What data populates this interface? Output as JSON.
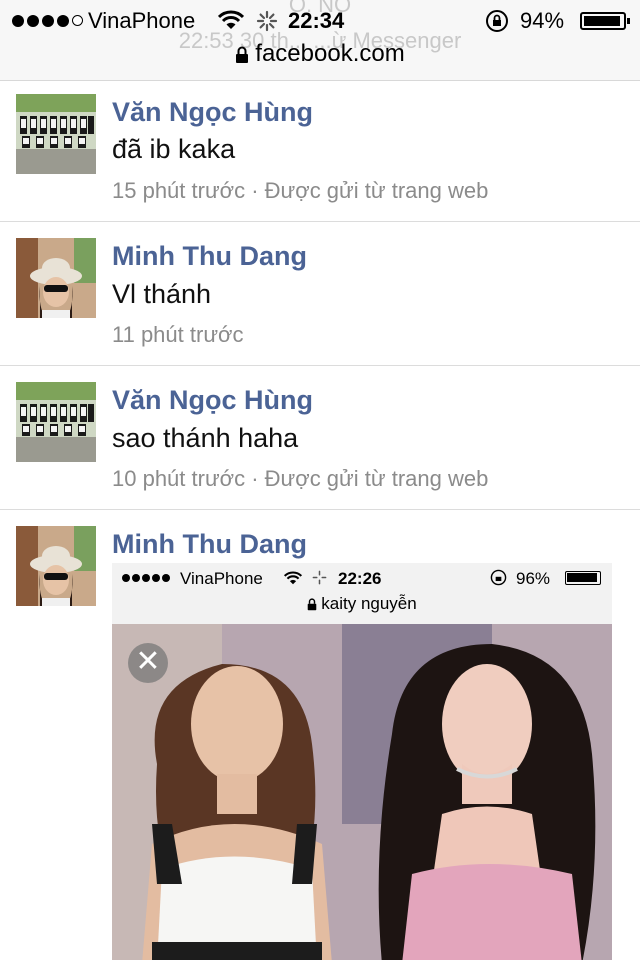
{
  "status_bar": {
    "carrier": "VinaPhone",
    "time": "22:34",
    "battery": "94%",
    "battery_level": 0.94,
    "url": "facebook.com",
    "ghost_top": "Ô. NO",
    "ghost_text": "22:53 30 th... ...ừ Messenger"
  },
  "messages": [
    {
      "name": "Văn Ngọc Hùng",
      "text": "đã ib kaka",
      "meta": "15 phút trước · Được gửi từ trang web",
      "avatar": "group-photo-avatar"
    },
    {
      "name": "Minh Thu Dang",
      "text": "Vl thánh",
      "meta": "11 phút trước",
      "avatar": "woman-hat-avatar"
    },
    {
      "name": "Văn Ngọc Hùng",
      "text": "sao thánh haha",
      "meta": "10 phút trước · Được gửi từ trang web",
      "avatar": "group-photo-avatar"
    },
    {
      "name": "Minh Thu Dang",
      "avatar": "woman-hat-avatar"
    }
  ],
  "attachment": {
    "carrier": "VinaPhone",
    "time": "22:26",
    "battery": "96%",
    "battery_level": 0.96,
    "address": "kaity nguyễn",
    "close_icon": "close-icon"
  },
  "colors": {
    "name": "#4b6395",
    "meta": "#8b8b8b",
    "divider": "#dcdcdc"
  }
}
